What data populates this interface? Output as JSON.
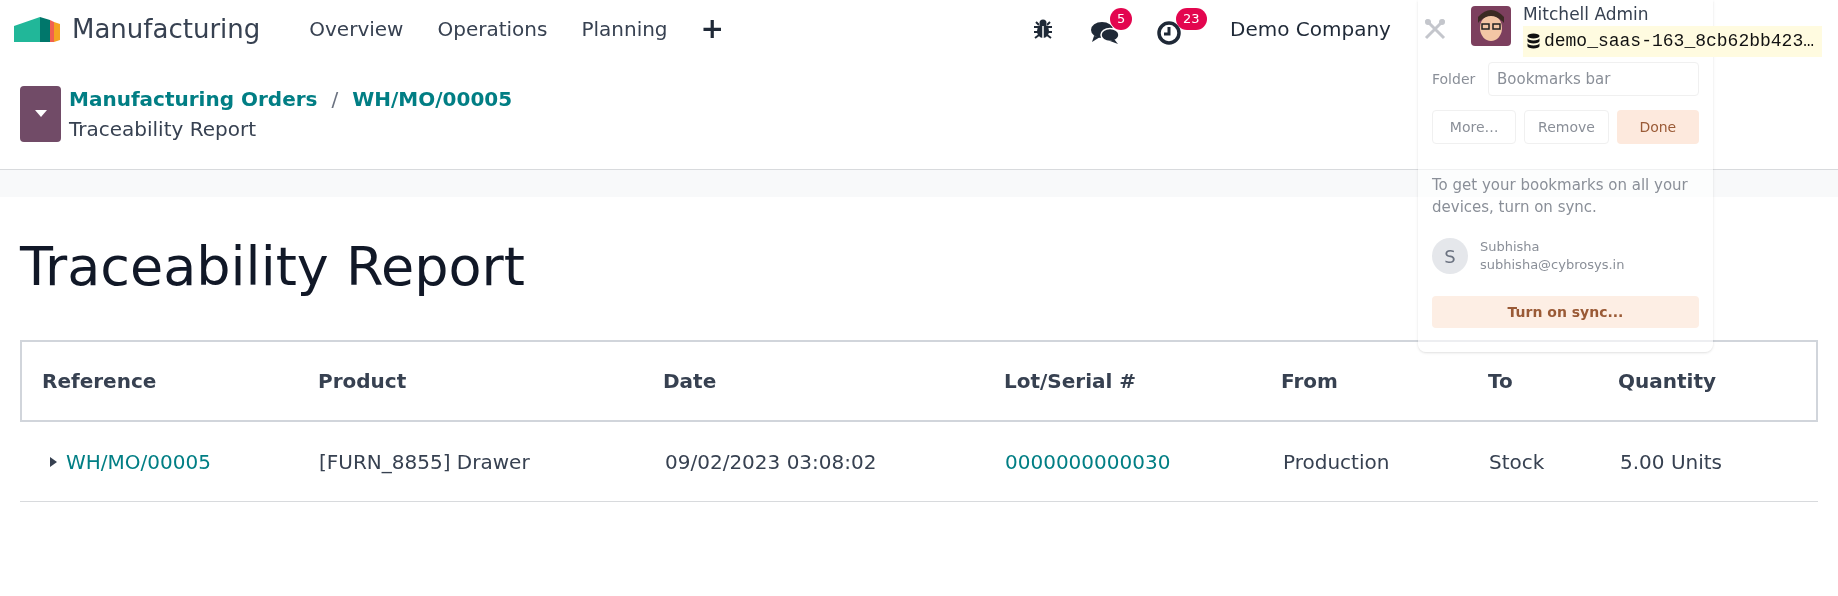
{
  "navbar": {
    "app_name": "Manufacturing",
    "menu": [
      "Overview",
      "Operations",
      "Planning"
    ],
    "add_symbol": "+",
    "messages_count": "5",
    "activities_count": "23",
    "company": "Demo Company",
    "user": {
      "name": "Mitchell Admin",
      "database": "demo_saas-163_8cb62bb423…"
    }
  },
  "breadcrumb": {
    "links": [
      "Manufacturing Orders",
      "WH/MO/00005"
    ],
    "separator": "/",
    "current": "Traceability Report"
  },
  "title": "Traceability Report",
  "table": {
    "columns": [
      "Reference",
      "Product",
      "Date",
      "Lot/Serial #",
      "From",
      "To",
      "Quantity"
    ],
    "rows": [
      {
        "expanded": false,
        "reference": "WH/MO/00005",
        "product": "[FURN_8855] Drawer",
        "date": "09/02/2023 03:08:02",
        "lot": "0000000000030",
        "from": "Production",
        "to": "Stock",
        "quantity": "5.00 Units"
      }
    ]
  },
  "bookmark_popup": {
    "folder_label": "Folder",
    "folder_value": "Bookmarks bar",
    "buttons": [
      "More…",
      "Remove",
      "Done"
    ],
    "sync_text": "To get your bookmarks on all your devices, turn on sync.",
    "account_initial": "S",
    "account_name": "Subhisha",
    "account_email": "subhisha@cybrosys.in",
    "sync_button": "Turn on sync..."
  }
}
